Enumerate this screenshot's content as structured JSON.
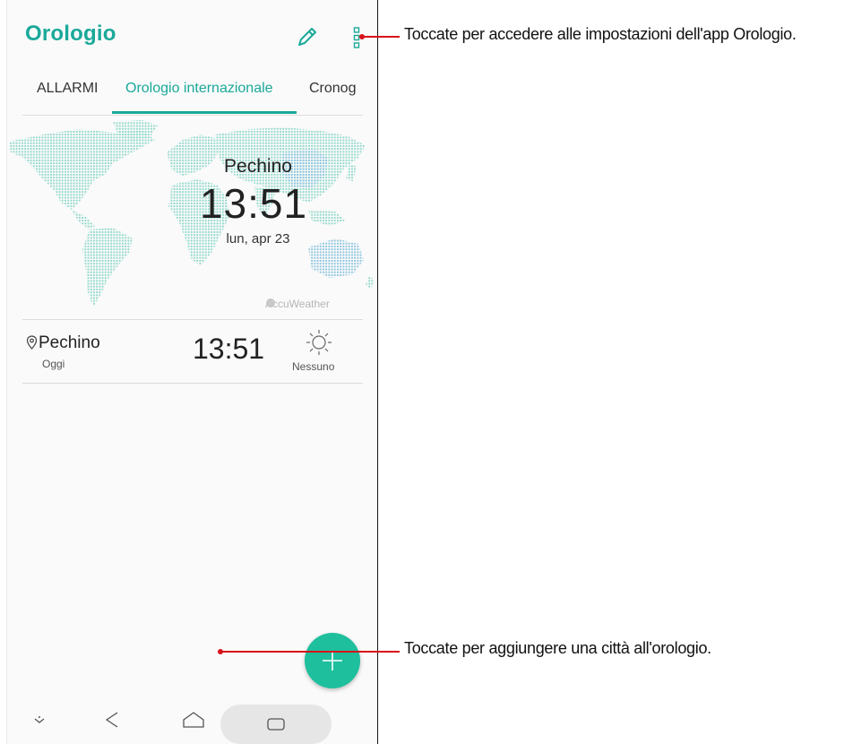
{
  "app": {
    "title": "Orologio"
  },
  "tabs": [
    {
      "label": "ALLARMI"
    },
    {
      "label": "Orologio internazionale",
      "selected": true
    },
    {
      "label": "Cronog"
    }
  ],
  "map": {
    "city": "Pechino",
    "time": "13:51",
    "date": "lun, apr 23",
    "provider": "AccuWeather"
  },
  "clocks": [
    {
      "city": "Pechino",
      "day": "Oggi",
      "time": "13:51",
      "weather": "Nessuno",
      "weather_icon": "sun-icon"
    }
  ],
  "callouts": {
    "settings": "Toccate per accedere alle impostazioni dell'app Orologio.",
    "add_city": "Toccate per aggiungere una città all'orologio."
  },
  "colors": {
    "accent": "#1aa99a",
    "fab": "#1ebf9d",
    "callout": "#d8121a"
  },
  "icons": [
    "pencil-icon",
    "more-vert-icon",
    "location-pin-icon",
    "sun-icon",
    "plus-icon",
    "chevron-down-icon",
    "back-icon",
    "home-icon",
    "recent-apps-icon"
  ]
}
